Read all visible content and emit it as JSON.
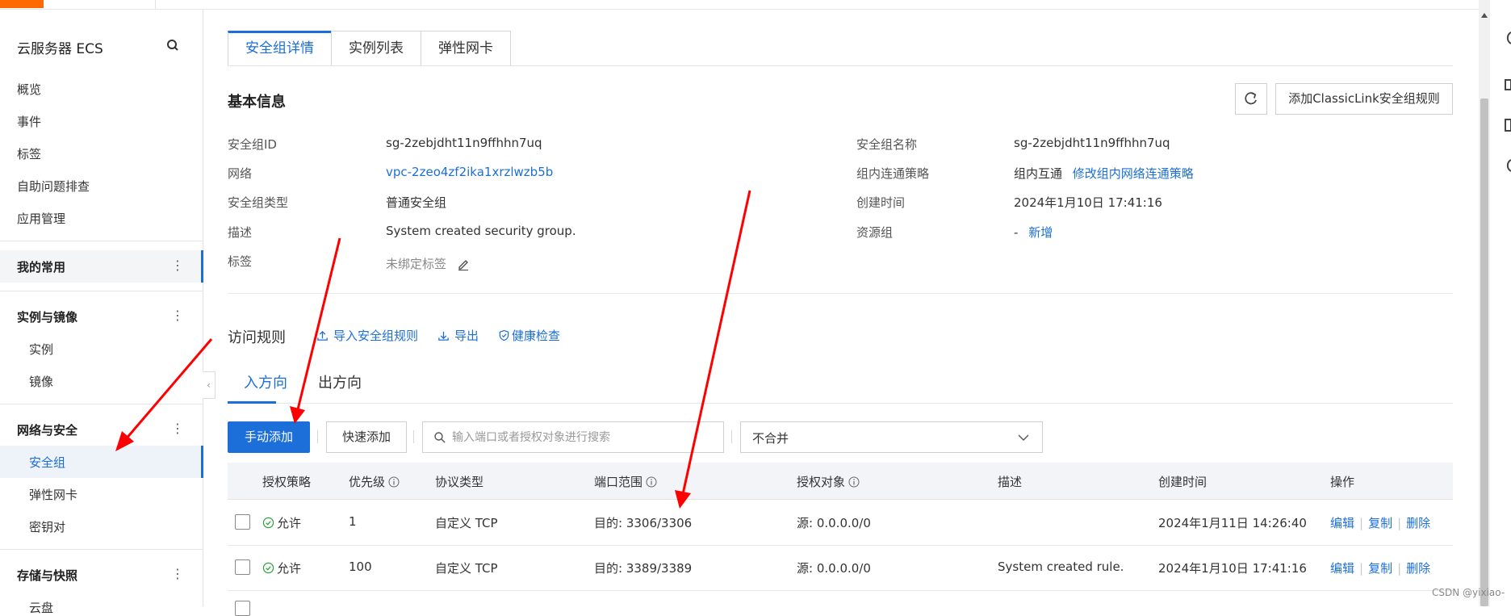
{
  "sidebar": {
    "title": "云服务器 ECS",
    "items": [
      "概览",
      "事件",
      "标签",
      "自助问题排查",
      "应用管理"
    ],
    "favorites_label": "我的常用",
    "groups": [
      {
        "label": "实例与镜像",
        "children": [
          "实例",
          "镜像"
        ]
      },
      {
        "label": "网络与安全",
        "children": [
          "安全组",
          "弹性网卡",
          "密钥对"
        ]
      },
      {
        "label": "存储与快照",
        "children": [
          "云盘"
        ]
      }
    ],
    "active_item": "安全组"
  },
  "tabs": [
    "安全组详情",
    "实例列表",
    "弹性网卡"
  ],
  "basic_info": {
    "title": "基本信息",
    "classiclink_button": "添加ClassicLink安全组规则",
    "left": [
      {
        "label": "安全组ID",
        "value": "sg-2zebjdht11n9ffhhn7uq"
      },
      {
        "label": "网络",
        "value": "vpc-2zeo4zf2ika1xrzlwzb5b"
      },
      {
        "label": "安全组类型",
        "value": "普通安全组"
      },
      {
        "label": "描述",
        "value": "System created security group."
      },
      {
        "label": "标签",
        "value": "未绑定标签"
      }
    ],
    "right": [
      {
        "label": "安全组名称",
        "value": "sg-2zebjdht11n9ffhhn7uq"
      },
      {
        "label": "组内连通策略",
        "value": "组内互通",
        "link": "修改组内网络连通策略"
      },
      {
        "label": "创建时间",
        "value": "2024年1月10日 17:41:16"
      },
      {
        "label": "资源组",
        "value": "-",
        "link": "新增"
      }
    ]
  },
  "access_rules": {
    "title": "访问规则",
    "actions": [
      "导入安全组规则",
      "导出",
      "健康检查"
    ],
    "directions": [
      "入方向",
      "出方向"
    ],
    "add_manual": "手动添加",
    "add_quick": "快速添加",
    "search_placeholder": "输入端口或者授权对象进行搜索",
    "merge_select": "不合并",
    "columns": [
      "授权策略",
      "优先级",
      "协议类型",
      "端口范围",
      "授权对象",
      "描述",
      "创建时间",
      "操作"
    ],
    "rows": [
      {
        "policy": "允许",
        "priority": "1",
        "protocol": "自定义 TCP",
        "port": "目的: 3306/3306",
        "object": "源: 0.0.0.0/0",
        "desc": "",
        "created": "2024年1月11日 14:26:40"
      },
      {
        "policy": "允许",
        "priority": "100",
        "protocol": "自定义 TCP",
        "port": "目的: 3389/3389",
        "object": "源: 0.0.0.0/0",
        "desc": "System created rule.",
        "created": "2024年1月10日 17:41:16"
      }
    ],
    "row_actions": [
      "编辑",
      "复制",
      "删除"
    ]
  },
  "watermark": "CSDN @yixiao-",
  "colors": {
    "accent": "#1c6fd8",
    "brand": "#ff6a00",
    "annotation": "#ff0000",
    "success": "#2fa33a"
  }
}
